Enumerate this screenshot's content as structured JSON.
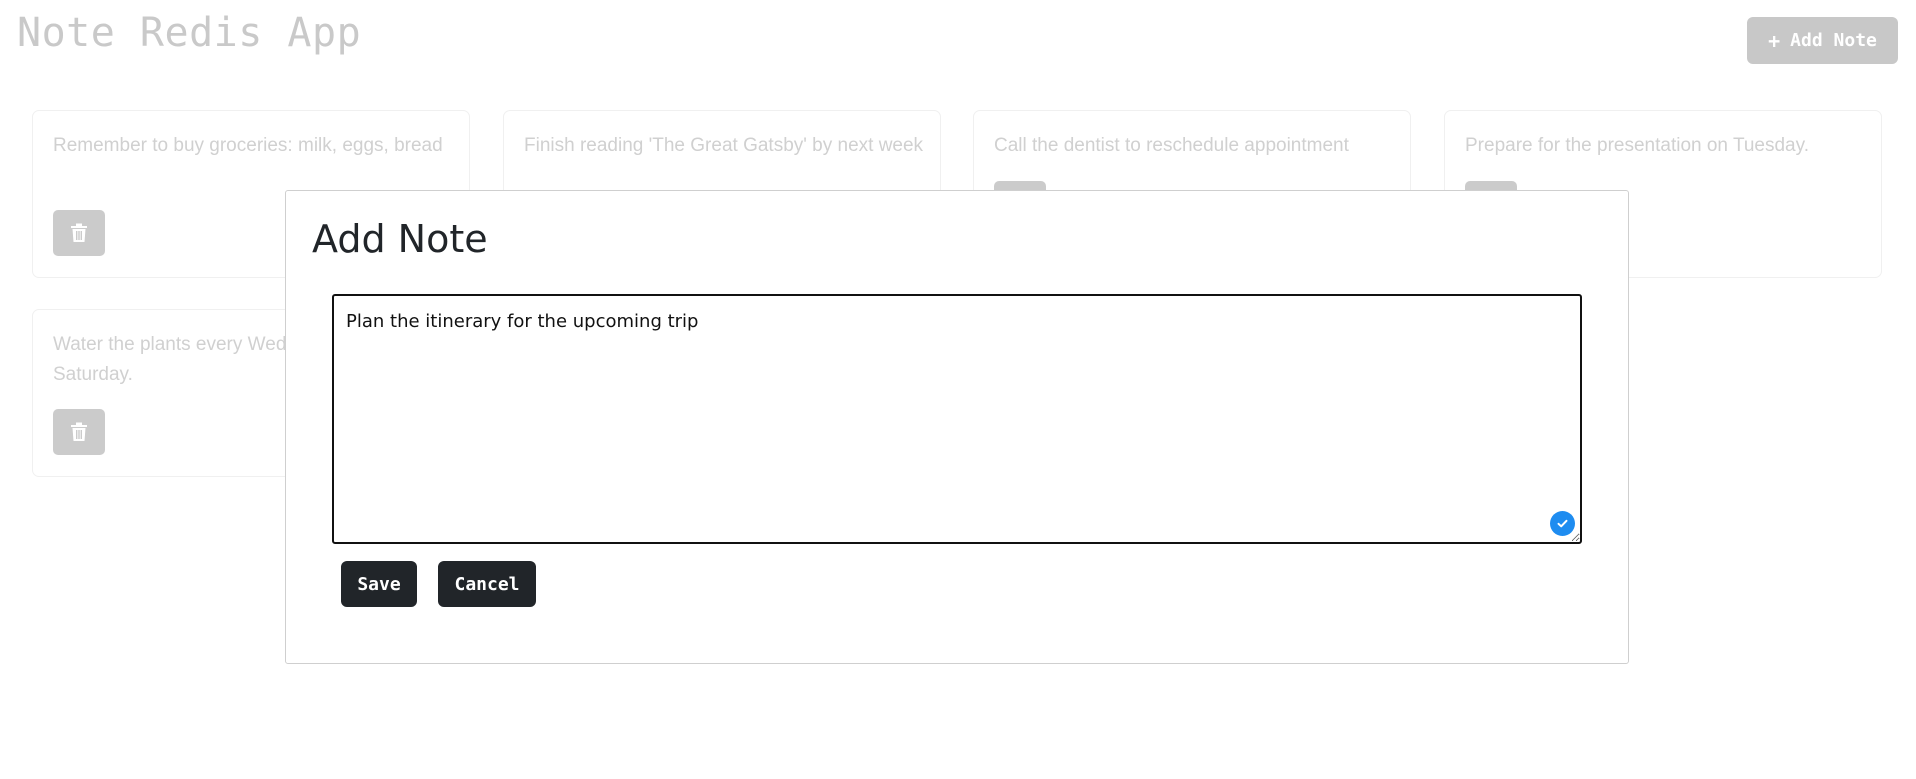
{
  "app": {
    "title": "Note Redis App",
    "add_note_label": "Add Note",
    "add_note_icon": "plus-icon"
  },
  "notes": [
    {
      "text": "Remember to buy groceries: milk, eggs, bread",
      "icon": "trash-icon"
    },
    {
      "text": "Finish reading 'The Great Gatsby' by next week",
      "icon": "trash-icon"
    },
    {
      "text": "Call the dentist to reschedule appointment",
      "icon": "trash-icon"
    },
    {
      "text": "Prepare for the presentation on Tuesday.",
      "icon": "trash-icon"
    },
    {
      "text": "Water the plants every Wednesday and Saturday.",
      "icon": "trash-icon"
    }
  ],
  "modal": {
    "title": "Add Note",
    "textarea_value": "Plan the itinerary for the upcoming trip",
    "save_label": "Save",
    "cancel_label": "Cancel",
    "check_icon": "checkmark-icon"
  },
  "colors": {
    "dark_button": "#212529",
    "faded_button": "#c8c8c8",
    "faded_text": "#d0d0d0",
    "check_badge": "#1e8cf0"
  }
}
